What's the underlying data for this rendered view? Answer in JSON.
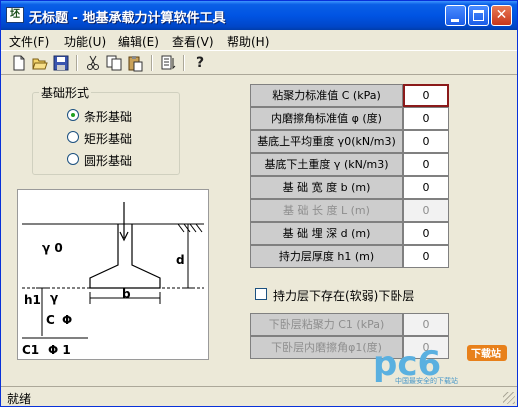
{
  "window": {
    "title": "无标题 - 地基承载力计算软件工具"
  },
  "menu": [
    "文件(F)",
    "功能(U)",
    "编辑(E)",
    "查看(V)",
    "帮助(H)"
  ],
  "toolbar": [
    "new-icon",
    "open-icon",
    "save-icon",
    "cut-icon",
    "copy-icon",
    "paste-icon",
    "print-icon",
    "help-icon"
  ],
  "foundation_group": {
    "label": "基础形式",
    "options": [
      "条形基础",
      "矩形基础",
      "圆形基础"
    ],
    "selected": "条形基础"
  },
  "diagram": {
    "labels": {
      "gamma0": "γ 0",
      "h1": "h1",
      "gamma": "γ",
      "c": "C",
      "phi": "Φ",
      "c1": "C1",
      "phi1": "Φ 1",
      "d": "d",
      "b": "b"
    }
  },
  "params": [
    {
      "label": "粘聚力标准值 C  (kPa)",
      "value": "0"
    },
    {
      "label": "内磨擦角标准值 φ (度)",
      "value": "0"
    },
    {
      "label": "基底上平均重度 γ0(kN/m3)",
      "value": "0"
    },
    {
      "label": "基底下土重度 γ (kN/m3)",
      "value": "0"
    },
    {
      "label": "基 础 宽 度  b    (m)",
      "value": "0"
    },
    {
      "label": "基 础 长 度  L    (m)",
      "value": "0"
    },
    {
      "label": "基 础 埋 深  d    (m)",
      "value": "0"
    },
    {
      "label": "持力层厚度  h1    (m)",
      "value": "0"
    }
  ],
  "soft_layer": {
    "checkbox_label": "持力层下存在(软弱)下卧层",
    "checked": false,
    "params": [
      {
        "label": "下卧层粘聚力 C1 (kPa)",
        "value": "0"
      },
      {
        "label": "下卧层内磨擦角φ1(度)",
        "value": "0"
      }
    ]
  },
  "status": {
    "text": "就绪"
  },
  "watermark": {
    "logo": "pc6",
    "badge": "下载站",
    "tagline": "中国最安全的下载站"
  }
}
